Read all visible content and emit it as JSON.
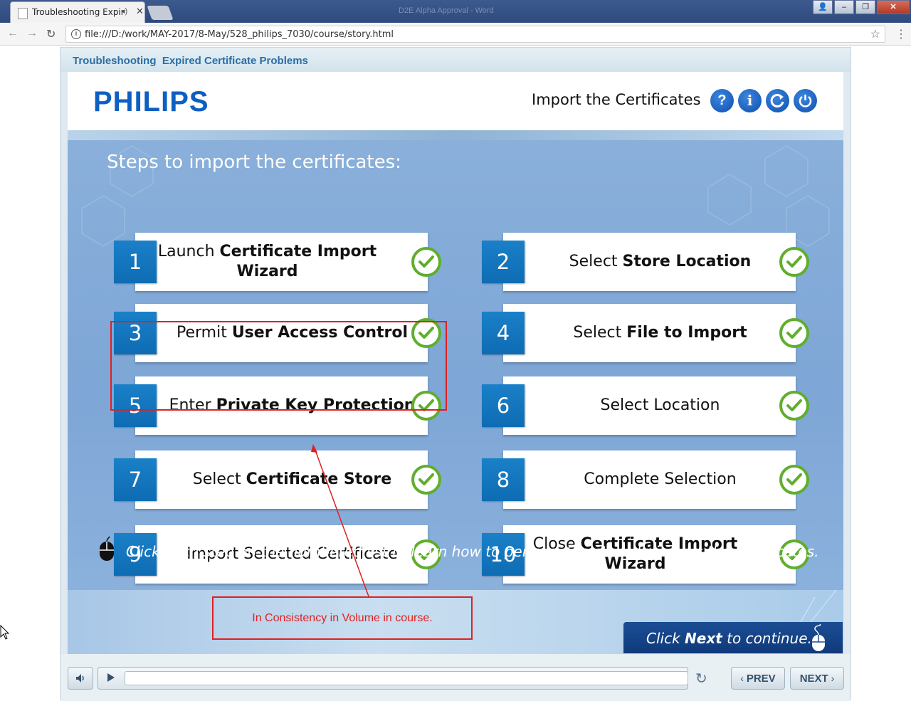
{
  "browser": {
    "tab_title": "Troubleshooting Expir",
    "window_title": "D2E Alpha Approval - Word",
    "url": "file:///D:/work/MAY-2017/8-May/528_philips_7030/course/story.html"
  },
  "course": {
    "title": "Troubleshooting  Expired Certificate Problems",
    "logo": "PHILIPS",
    "slide_title": "Import the Certificates",
    "header_buttons": [
      "help-icon",
      "info-icon",
      "replay-icon",
      "power-icon"
    ],
    "steps_heading": "Steps to import the certificates:",
    "steps": [
      {
        "num": "1",
        "pre": "Launch ",
        "bold": "Certificate Import Wizard",
        "post": ""
      },
      {
        "num": "2",
        "pre": "Select ",
        "bold": "Store Location",
        "post": ""
      },
      {
        "num": "3",
        "pre": "Permit ",
        "bold": "User Access Control",
        "post": ""
      },
      {
        "num": "4",
        "pre": "Select ",
        "bold": "File to Import",
        "post": ""
      },
      {
        "num": "5",
        "pre": "Enter ",
        "bold": "Private Key Protection",
        "post": ""
      },
      {
        "num": "6",
        "pre": "Select Location",
        "bold": "",
        "post": ""
      },
      {
        "num": "7",
        "pre": "Select ",
        "bold": "Certificate Store",
        "post": ""
      },
      {
        "num": "8",
        "pre": "Complete Selection",
        "bold": "",
        "post": ""
      },
      {
        "num": "9",
        "pre": "Import Selected Certificate",
        "bold": "",
        "post": ""
      },
      {
        "num": "10",
        "pre": "Close ",
        "bold": "Certificate Import Wizard",
        "post": ""
      }
    ],
    "instruction": "Click each step on the numbered list to learn how to perform the steps to import the certificates.",
    "next_hint": {
      "pre": "Click ",
      "bold": "Next",
      "post": " to continue."
    },
    "player": {
      "prev_label": "PREV",
      "next_label": "NEXT"
    }
  },
  "annotation": {
    "note": "In Consistency in Volume in course.",
    "color": "#e02020"
  },
  "colors": {
    "brand_blue": "#0e5fc2",
    "step_number_bg": "#0e6cb3",
    "check_green": "#5fae2d",
    "content_bg": "#7ea6d6"
  }
}
